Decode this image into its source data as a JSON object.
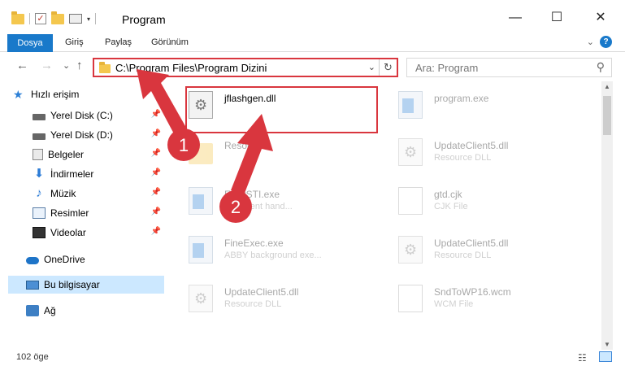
{
  "window": {
    "title": "Program",
    "minimize": "—",
    "maximize": "☐",
    "close": "✕"
  },
  "quick_access_toolbar": {
    "icons": [
      "folder-icon",
      "properties-check-icon",
      "new-folder-icon",
      "properties-icon"
    ],
    "dropdown": "▾"
  },
  "ribbon": {
    "tabs": [
      "Dosya",
      "Giriş",
      "Paylaş",
      "Görünüm"
    ],
    "expand": "⌄",
    "help": "?"
  },
  "navigation": {
    "back": "←",
    "forward": "→",
    "recent": "⌄",
    "up": "↑",
    "address": "C:\\Program Files\\Program Dizini",
    "address_dropdown": "⌄",
    "refresh": "↻",
    "search_placeholder": "Ara: Program",
    "search_icon": "⚲"
  },
  "sidebar": {
    "items": [
      {
        "label": "Hızlı erişim",
        "icon": "star-icon",
        "pinned": false
      },
      {
        "label": "Yerel Disk (C:)",
        "icon": "drive-icon",
        "pinned": true
      },
      {
        "label": "Yerel Disk (D:)",
        "icon": "drive-icon",
        "pinned": true
      },
      {
        "label": "Belgeler",
        "icon": "documents-icon",
        "pinned": true
      },
      {
        "label": "İndirmeler",
        "icon": "downloads-icon",
        "pinned": true
      },
      {
        "label": "Müzik",
        "icon": "music-icon",
        "pinned": true
      },
      {
        "label": "Resimler",
        "icon": "pictures-icon",
        "pinned": true
      },
      {
        "label": "Videolar",
        "icon": "videos-icon",
        "pinned": true
      },
      {
        "label": "OneDrive",
        "icon": "onedrive-icon",
        "pinned": false
      },
      {
        "label": "Bu bilgisayar",
        "icon": "this-pc-icon",
        "pinned": false,
        "selected": true
      },
      {
        "label": "Ağ",
        "icon": "network-icon",
        "pinned": false
      }
    ],
    "pin_glyph": "📌"
  },
  "files": [
    {
      "name": "jflashgen.dll",
      "type": "",
      "icon": "dll-gear-icon",
      "highlighted": true
    },
    {
      "name": "program.exe",
      "type": "",
      "icon": "exe-icon"
    },
    {
      "name": "Resource",
      "type": "",
      "icon": "folder-icon"
    },
    {
      "name": "UpdateClient5.dll",
      "type": "Resource DLL",
      "icon": "dll-gear-icon"
    },
    {
      "name": "EasySTI.exe",
      "type": "STI event hand...",
      "icon": "exe-icon"
    },
    {
      "name": "gtd.cjk",
      "type": "CJK File",
      "icon": "file-icon"
    },
    {
      "name": "FineExec.exe",
      "type": "ABBY background exe...",
      "icon": "exe-icon"
    },
    {
      "name": "UpdateClient5.dll",
      "type": "Resource DLL",
      "icon": "dll-gear-icon"
    },
    {
      "name": "UpdateClient5.dll",
      "type": "Resource DLL",
      "icon": "dll-gear-icon"
    },
    {
      "name": "SndToWP16.wcm",
      "type": "WCM File",
      "icon": "file-icon"
    }
  ],
  "annotations": [
    {
      "label": "1"
    },
    {
      "label": "2"
    }
  ],
  "colors": {
    "accent": "#1979ca",
    "highlight_red": "#d9363e",
    "selection": "#cce8ff"
  },
  "status": {
    "item_count": "102 öge"
  }
}
